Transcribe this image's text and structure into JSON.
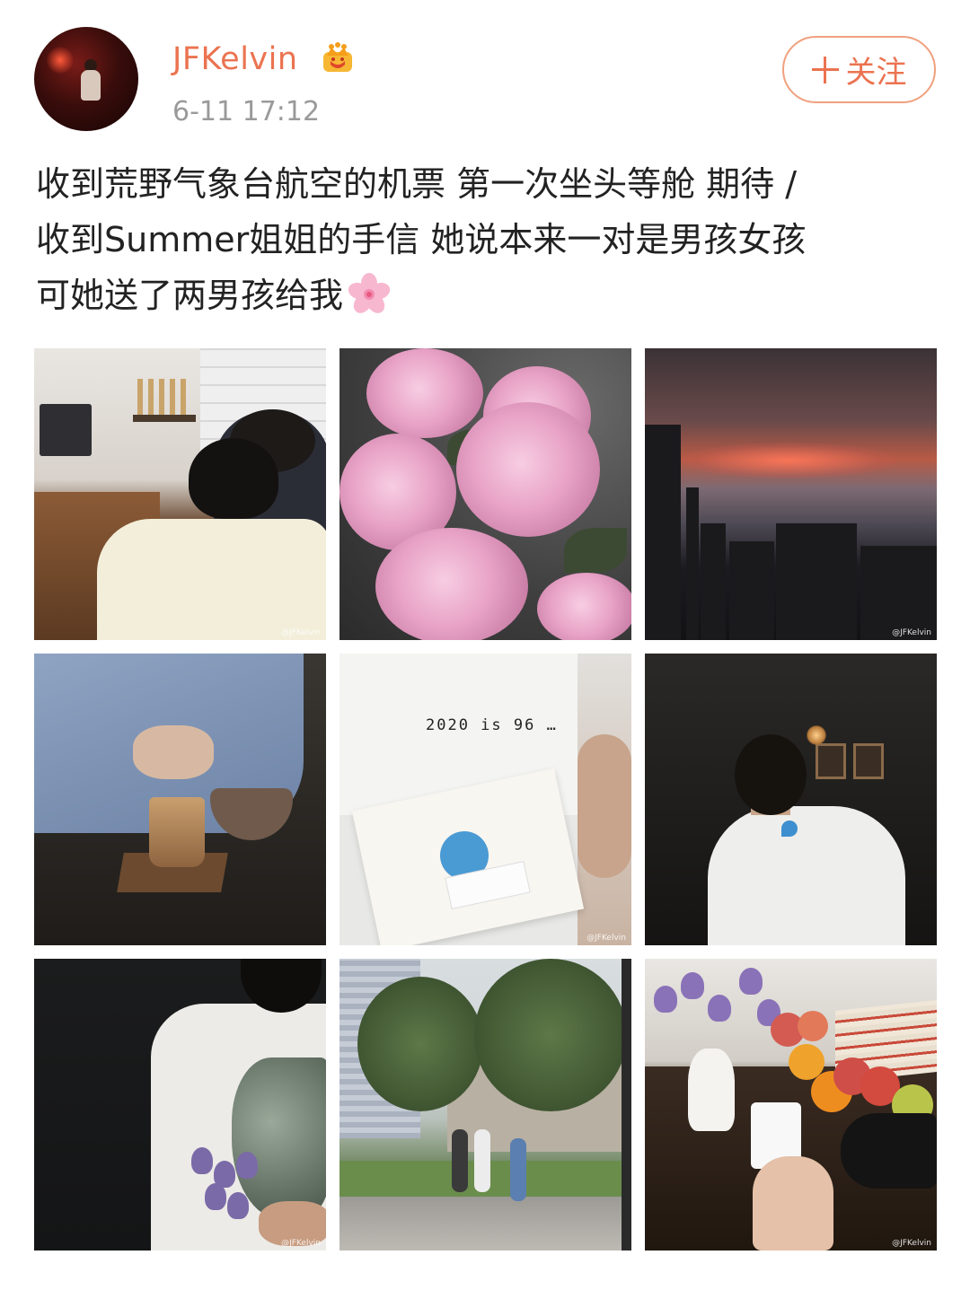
{
  "user": {
    "name": "JFKelvin",
    "badge_icon": "crown-icon",
    "timestamp": "6-11 17:12",
    "accent_color": "#eb7350"
  },
  "follow": {
    "label": "关注",
    "icon": "plus-icon"
  },
  "post": {
    "lines": [
      "收到荒野气象台航空的机票 第一次坐头等舱 期待 /",
      "收到Summer姐姐的手信 她说本来一对是男孩女孩",
      "可她送了两男孩给我"
    ],
    "emoji": "cherry-blossom-icon"
  },
  "photos": {
    "watermark": "@JFKelvin",
    "items": [
      {
        "subject": "cafe-bar"
      },
      {
        "subject": "peonies"
      },
      {
        "subject": "sunset-skyline"
      },
      {
        "subject": "latte"
      },
      {
        "subject": "tshirt-envelope"
      },
      {
        "subject": "man-white-tee"
      },
      {
        "subject": "tulip-bouquet"
      },
      {
        "subject": "courtyard"
      },
      {
        "subject": "still-life"
      }
    ],
    "tee_print": "2020 is 96 …"
  }
}
